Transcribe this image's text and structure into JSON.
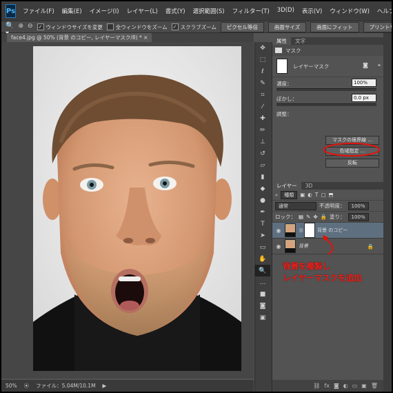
{
  "app": {
    "logo": "Ps"
  },
  "menu": [
    "ファイル(F)",
    "編集(E)",
    "イメージ(I)",
    "レイヤー(L)",
    "書式(Y)",
    "選択範囲(S)",
    "フィルター(T)",
    "3D(D)",
    "表示(V)",
    "ウィンドウ(W)",
    "ヘルプ(H)"
  ],
  "window_controls": {
    "minimize": "–",
    "maximize": "□",
    "close": "✕"
  },
  "options": {
    "tool_icon": "zoom-icon",
    "zoom_in": "⊕",
    "zoom_out": "⊖",
    "resize_windows": "ウィンドウサイズを変更",
    "zoom_all_windows": "全ウィンドウをズーム",
    "scrubby_zoom": "スクラブズーム",
    "btn_actual_pixels": "ピクセル等倍",
    "btn_fit_screen": "画面サイズ",
    "btn_fill_screen": "画面にフィット",
    "btn_print_size": "プリントサイズ"
  },
  "document": {
    "tab_title": "face4.jpg @ 50% (背景 のコピー, レイヤーマスク/8) *",
    "close": "×"
  },
  "status": {
    "zoom": "50%",
    "file_info": "ファイル：5.04M/10.1M",
    "arrow": "▶"
  },
  "properties": {
    "tabs": [
      "属性",
      "文字"
    ],
    "header": "マスク",
    "mask_label": "レイヤーマスク",
    "density_label": "濃度：",
    "density_value": "100%",
    "feather_label": "ぼかし：",
    "feather_value": "0.0 px",
    "refine_label": "調整：",
    "btn_mask_edge": "マスクの境界線 ...",
    "btn_color_range": "色域指定 ...",
    "btn_invert": "反転"
  },
  "layers": {
    "tabs": [
      "レイヤー",
      "3D"
    ],
    "filter_kind": "種類",
    "blend_mode": "通常",
    "opacity_label": "不透明度：",
    "opacity_value": "100%",
    "lock_label": "ロック：",
    "fill_label": "塗り：",
    "fill_value": "100%",
    "items": [
      {
        "name": "背景 のコピー"
      },
      {
        "name": "背景"
      }
    ]
  },
  "annotation": {
    "line1": "背景を複製し",
    "line2": "レイヤーマスクを追加"
  },
  "colors": {
    "highlight": "#e3120b",
    "annotation_text": "#f2231d",
    "selected_layer": "#5e6f80"
  }
}
